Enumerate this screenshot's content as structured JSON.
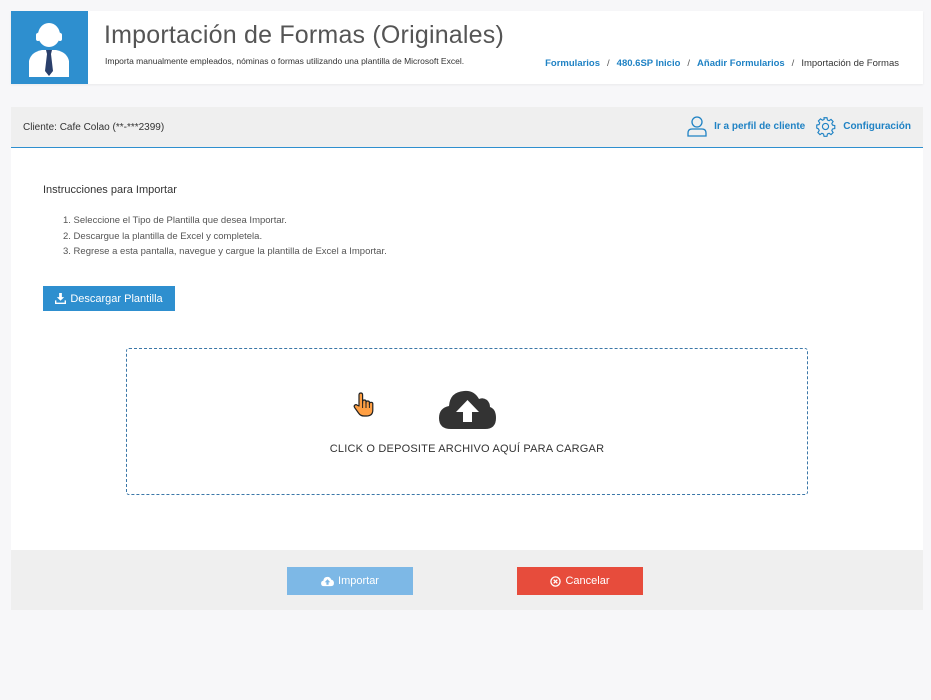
{
  "header": {
    "title": "Importación de Formas (Originales)",
    "subtitle": "Importa manualmente empleados, nóminas o formas utilizando una plantilla de Microsoft Excel.",
    "breadcrumb": [
      {
        "label": "Formularios"
      },
      {
        "label": "480.6SP Inicio"
      },
      {
        "label": "Añadir Formularios"
      },
      {
        "label": "Importación de Formas"
      }
    ],
    "breadcrumb_separator": "/"
  },
  "client_bar": {
    "label": "Cliente:",
    "name": "Cafe Colao (**-***2399)",
    "profile_link": "Ir a perfil de cliente",
    "settings_link": "Configuración"
  },
  "instructions": {
    "title": "Instrucciones para Importar",
    "steps": [
      "1. Seleccione el Tipo de Plantilla que desea Importar.",
      "2. Descargue la plantilla de Excel y completela.",
      "3. Regrese a esta pantalla, navegue y cargue la plantilla de Excel a Importar."
    ]
  },
  "download_button": "Descargar Plantilla",
  "dropzone": {
    "text": "CLICK O DEPOSITE ARCHIVO AQUÍ PARA CARGAR",
    "icon": "cloud-upload-icon"
  },
  "footer": {
    "import_label": "Importar",
    "cancel_label": "Cancelar"
  },
  "colors": {
    "brand": "#2e8fcf",
    "link": "#1f82c4",
    "import_disabled": "#7db8e6",
    "cancel": "#e74c3c"
  }
}
